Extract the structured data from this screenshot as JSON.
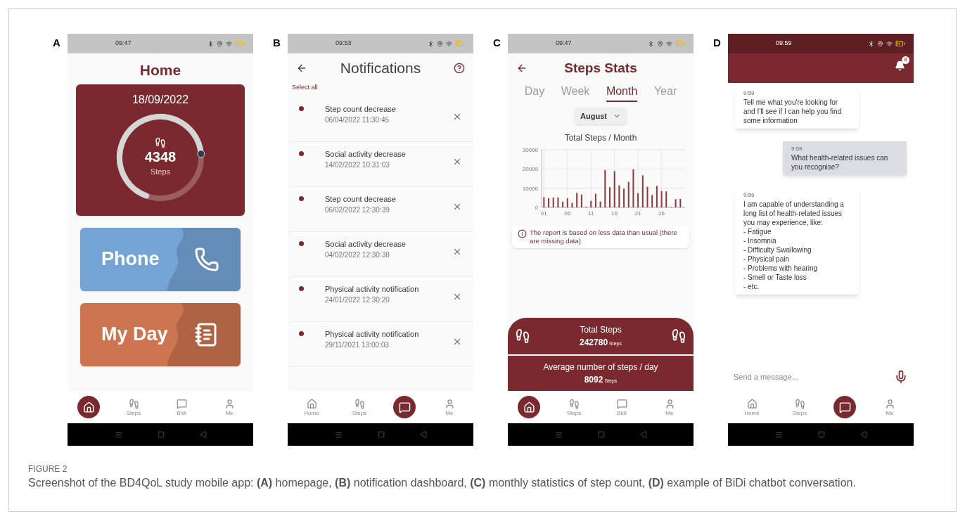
{
  "panels": [
    {
      "letter": "A",
      "kind": "home",
      "status": {
        "time": "09:47"
      },
      "title": "Home",
      "date": "18/09/2022",
      "steps": "4348",
      "steps_unit": "Steps",
      "ring": {
        "level": 0.68
      },
      "cards": [
        {
          "label": "Phone",
          "kind": "phone",
          "color": "#74a3d6"
        },
        {
          "label": "My Day",
          "kind": "diary",
          "color": "#cd7450"
        }
      ],
      "nav": [
        {
          "kind": "home",
          "selected": true
        },
        {
          "kind": "steps",
          "label": "Steps",
          "selected": false
        },
        {
          "kind": "chat",
          "label": "Bidi",
          "selected": false
        },
        {
          "kind": "user",
          "label": "Me",
          "selected": false
        }
      ]
    },
    {
      "letter": "B",
      "kind": "notifications",
      "status": {
        "time": "09:53"
      },
      "title": "Notifications",
      "select_all": "Select all",
      "items": [
        {
          "title": "Step count decrease",
          "time": "06/04/2022 11:30:45",
          "unread": true
        },
        {
          "title": "Social activity decrease",
          "time": "14/02/2022 10:31:03",
          "unread": true
        },
        {
          "title": "Step count decrease",
          "time": "06/02/2022 12:30:39",
          "unread": true
        },
        {
          "title": "Social activity decrease",
          "time": "04/02/2022 12:30:38",
          "unread": true
        },
        {
          "title": "Physical activity notification",
          "time": "24/01/2022 12:30:20",
          "unread": true
        },
        {
          "title": "Physical activity notification",
          "time": "29/11/2021 13:00:03",
          "unread": true
        }
      ],
      "nav": [
        {
          "kind": "home",
          "label": "Home",
          "selected": false
        },
        {
          "kind": "steps",
          "label": "Steps",
          "selected": false
        },
        {
          "kind": "chat",
          "selected": true
        },
        {
          "kind": "user",
          "label": "Me",
          "selected": false
        }
      ]
    },
    {
      "letter": "C",
      "kind": "stats",
      "status": {
        "time": "09:47"
      },
      "title": "Steps Stats",
      "tabs": [
        {
          "label": "Day",
          "selected": false
        },
        {
          "label": "Week",
          "selected": false
        },
        {
          "label": "Month",
          "selected": true
        },
        {
          "label": "Year",
          "selected": false
        }
      ],
      "month": "August",
      "chart_data": {
        "type": "bar",
        "title": "Total Steps / Month",
        "x": [
          1,
          2,
          3,
          4,
          5,
          6,
          7,
          8,
          9,
          10,
          11,
          12,
          13,
          14,
          15,
          16,
          17,
          18,
          19,
          20,
          21,
          22,
          23,
          24,
          25,
          26,
          27,
          28,
          29,
          30
        ],
        "xticks": [
          {
            "value": 1,
            "label": "01"
          },
          {
            "value": 6,
            "label": "06"
          },
          {
            "value": 11,
            "label": "11"
          },
          {
            "value": 16,
            "label": "16"
          },
          {
            "value": 21,
            "label": "21"
          },
          {
            "value": 26,
            "label": "26"
          }
        ],
        "xlim": [
          0.5,
          31
        ],
        "ylim": [
          0,
          30000
        ],
        "yticks": [
          0,
          10000,
          20000,
          30000
        ],
        "grid": true,
        "series": [
          {
            "color": "#8b3a3e",
            "values": [
              5300,
              4800,
              5200,
              5200,
              3000,
              4700,
              2400,
              7600,
              6700,
              400,
              3400,
              7100,
              3100,
              19400,
              10500,
              18900,
              11500,
              9700,
              13300,
              19800,
              7400,
              16700,
              10700,
              6500,
              11200,
              8500,
              8300,
              200,
              4300,
              4400
            ]
          }
        ]
      },
      "warning": "The report is based on less data than usual (there are missing data)",
      "summary": [
        {
          "label": "Total Steps",
          "value": "242780",
          "unit": "Steps"
        },
        {
          "label": "Average number of steps / day",
          "value": "8092",
          "unit": "Steps"
        }
      ],
      "nav": [
        {
          "kind": "home",
          "selected": true
        },
        {
          "kind": "steps",
          "label": "Steps",
          "selected": false
        },
        {
          "kind": "chat",
          "label": "Bidi",
          "selected": false
        },
        {
          "kind": "user",
          "label": "Me",
          "selected": false
        }
      ]
    },
    {
      "letter": "D",
      "kind": "chat",
      "status": {
        "time": "09:59"
      },
      "badge": "8",
      "messages": [
        {
          "kind": "bot",
          "time": "9:59",
          "text": "Tell me what you're looking for and I'll see if I can help you find some information"
        },
        {
          "kind": "user",
          "time": "9:59",
          "text": "What health-related issues can you recognise?"
        },
        {
          "kind": "bot",
          "time": "9:59",
          "text": "I am capable of understanding a long list of health-related issues you may experience, like:\n- Fatigue\n- Insomnia\n- Difficulty Swallowing\n- Physical pain\n- Problems with hearing\n- Smell or Taste loss\n- etc."
        }
      ],
      "input": {
        "placeholder": "Send a message..."
      },
      "nav": [
        {
          "kind": "home",
          "label": "Home",
          "selected": false
        },
        {
          "kind": "steps",
          "label": "Steps",
          "selected": false
        },
        {
          "kind": "chat",
          "selected": true
        },
        {
          "kind": "user",
          "label": "Me",
          "selected": false
        }
      ]
    }
  ],
  "caption": {
    "label": "FIGURE 2",
    "text": "Screenshot of the BD4QoL study mobile app: **(A)** homepage, **(B)** notification dashboard, **(C)** monthly statistics of step count,  **(D)** example of BiDi chatbot conversation."
  }
}
